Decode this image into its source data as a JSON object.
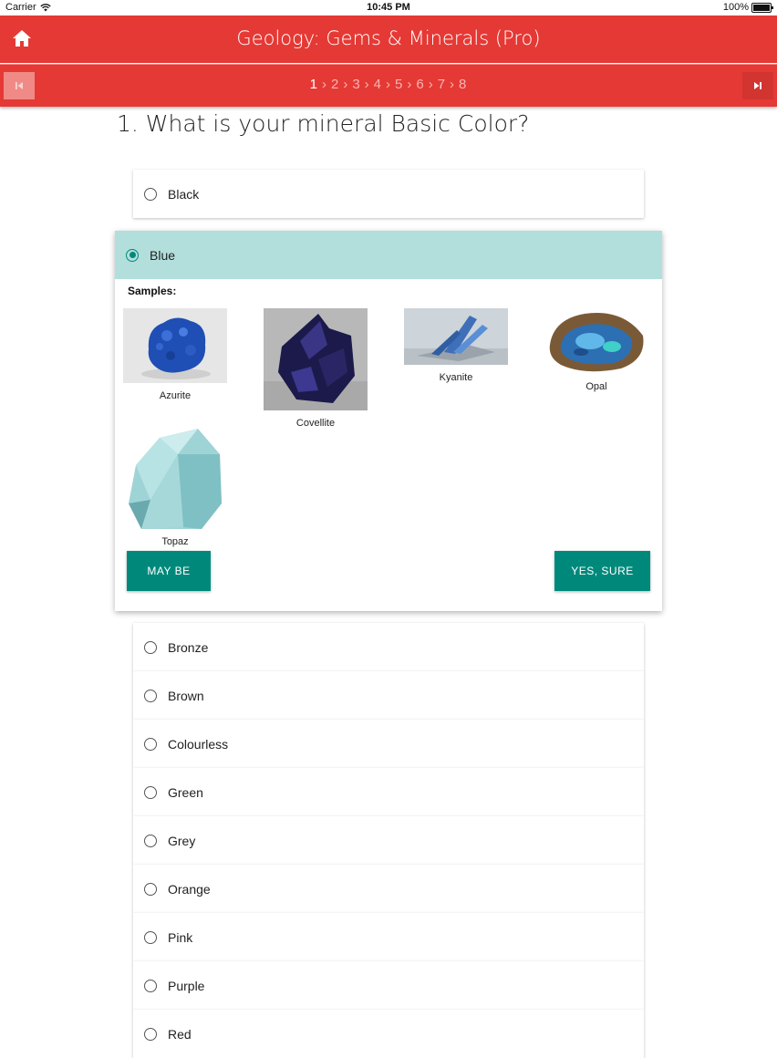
{
  "status_bar": {
    "carrier": "Carrier",
    "time": "10:45 PM",
    "battery": "100%"
  },
  "header": {
    "title": "Geology: Gems & Minerals (Pro)"
  },
  "steps": [
    "1",
    "2",
    "3",
    "4",
    "5",
    "6",
    "7",
    "8"
  ],
  "question": "1. What is your mineral Basic Color?",
  "options_top": [
    {
      "label": "Black"
    }
  ],
  "selected": {
    "label": "Blue",
    "samples_label": "Samples:",
    "samples": [
      {
        "name": "Azurite"
      },
      {
        "name": "Covellite"
      },
      {
        "name": "Kyanite"
      },
      {
        "name": "Opal"
      },
      {
        "name": "Topaz"
      }
    ],
    "maybe_label": "MAY BE",
    "sure_label": "YES, SURE"
  },
  "options_bottom": [
    {
      "label": "Bronze"
    },
    {
      "label": "Brown"
    },
    {
      "label": "Colourless"
    },
    {
      "label": "Green"
    },
    {
      "label": "Grey"
    },
    {
      "label": "Orange"
    },
    {
      "label": "Pink"
    },
    {
      "label": "Purple"
    },
    {
      "label": "Red"
    }
  ],
  "colors": {
    "header": "#e53935",
    "accent": "#00897b",
    "selected_bg": "#b2dfdb"
  }
}
